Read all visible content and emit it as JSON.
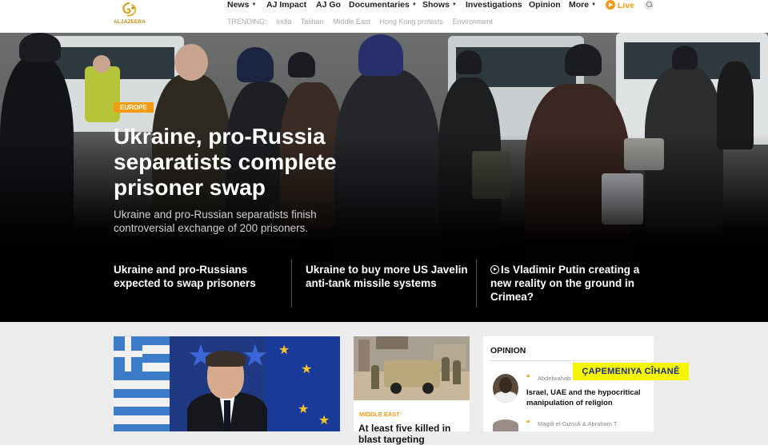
{
  "brand": {
    "logo_text": "ALJAZEERA",
    "accent_color": "#f39c12"
  },
  "nav": {
    "items": [
      {
        "label": "News",
        "has_dropdown": true
      },
      {
        "label": "AJ Impact",
        "has_dropdown": false
      },
      {
        "label": "AJ Go",
        "has_dropdown": false
      },
      {
        "label": "Documentaries",
        "has_dropdown": true
      },
      {
        "label": "Shows",
        "has_dropdown": true
      },
      {
        "label": "Investigations",
        "has_dropdown": false
      },
      {
        "label": "Opinion",
        "has_dropdown": false
      },
      {
        "label": "More",
        "has_dropdown": true
      }
    ],
    "live_label": "Live",
    "search_icon": "search-icon"
  },
  "trending": {
    "label": "TRENDING:",
    "topics": [
      "India",
      "Taliban",
      "Middle East",
      "Hong Kong protests",
      "Environment"
    ]
  },
  "hero": {
    "tag": "EUROPE",
    "title": "Ukraine, pro-Russia separatists complete prisoner swap",
    "subtitle": "Ukraine and pro-Russian separatists finish controversial exchange of 200 prisoners.",
    "related": [
      {
        "title": "Ukraine and pro-Russians expected to swap prisoners",
        "has_video": false
      },
      {
        "title": "Ukraine to buy more US Javelin anti-tank missile systems",
        "has_video": false
      },
      {
        "title": "Is Vladimir Putin creating a new reality on the ground in Crimea?",
        "has_video": true
      }
    ]
  },
  "card2": {
    "tag": "MIDDLE EAST",
    "title": "At least five killed in blast targeting"
  },
  "opinion": {
    "heading": "OPINION",
    "items": [
      {
        "author": "Abdelwahab",
        "title": "Israel, UAE and the hypocritical manipulation of religion"
      },
      {
        "author": "Magdi el-Gizouli & Abraham T",
        "title": ""
      }
    ]
  },
  "watermark": "ÇAPEMENIYA CÎHANÊ"
}
